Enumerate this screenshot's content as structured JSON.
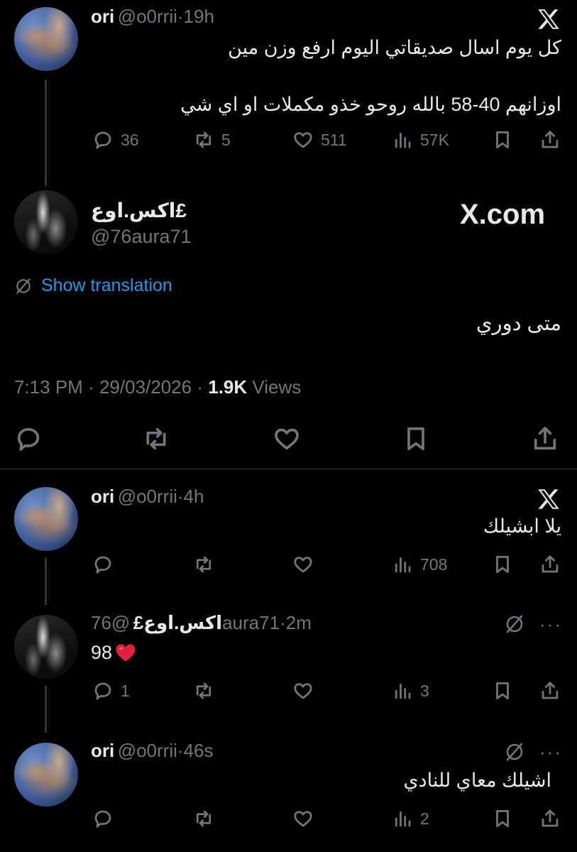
{
  "tweet1": {
    "name": "ori",
    "handle": "@o0rrii",
    "time": "19h",
    "line1": "كل يوم اسال صديقاتي اليوم ارفع وزن مين",
    "line2": "اوزانهم 40-58 بالله روحو خذو مكملات او اي شي",
    "replies": "36",
    "reposts": "5",
    "likes": "511",
    "views": "57K"
  },
  "main": {
    "name": "اكس.اوع£",
    "handle": "@76aura71",
    "brand": "X.com",
    "show_translation": "Show translation",
    "text": "متى دوري",
    "time": "7:13 PM",
    "date": "29/03/2026",
    "views_count": "1.9K",
    "views_label": "Views"
  },
  "reply1": {
    "name": "ori",
    "handle": "@o0rrii",
    "time": "4h",
    "text": "يلا ابشيلك",
    "views": "708"
  },
  "reply2": {
    "name": "اكس.اوع£",
    "handle": "@76aura71",
    "time": "2m",
    "text": "98",
    "replies": "1",
    "views": "3",
    "more": "···"
  },
  "reply3": {
    "name": "ori",
    "handle": "@o0rrii",
    "time": "46s",
    "text": "اشيلك معاي للنادي",
    "views": "2",
    "more": "···"
  },
  "sep": "·",
  "colors": {
    "background": "#000000",
    "text": "#e7e9ea",
    "muted": "#71767b",
    "link": "#1d9bf0",
    "heart": "#f91880"
  }
}
